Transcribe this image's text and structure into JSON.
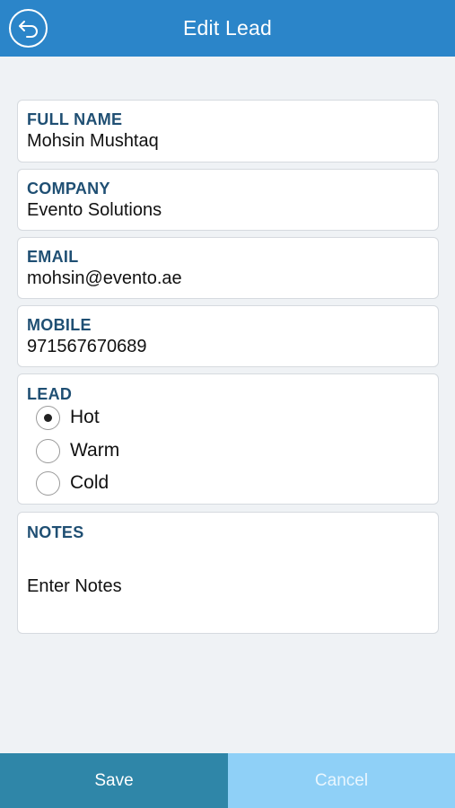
{
  "header": {
    "title": "Edit Lead",
    "back_icon": "back-arrow-circle-icon"
  },
  "fields": {
    "full_name": {
      "label": "FULL NAME",
      "value": "Mohsin Mushtaq"
    },
    "company": {
      "label": "COMPANY",
      "value": "Evento Solutions"
    },
    "email": {
      "label": "EMAIL",
      "value": "mohsin@evento.ae"
    },
    "mobile": {
      "label": "MOBILE",
      "value": "971567670689"
    }
  },
  "lead": {
    "label": "LEAD",
    "options": [
      {
        "label": "Hot",
        "selected": true
      },
      {
        "label": "Warm",
        "selected": false
      },
      {
        "label": "Cold",
        "selected": false
      }
    ]
  },
  "notes": {
    "label": "NOTES",
    "placeholder": "Enter Notes"
  },
  "footer": {
    "save_label": "Save",
    "cancel_label": "Cancel"
  },
  "colors": {
    "header": "#2b85c9",
    "label": "#1f4f73",
    "save": "#2f86a8",
    "cancel": "#8fd0f7",
    "background": "#eff2f5"
  }
}
